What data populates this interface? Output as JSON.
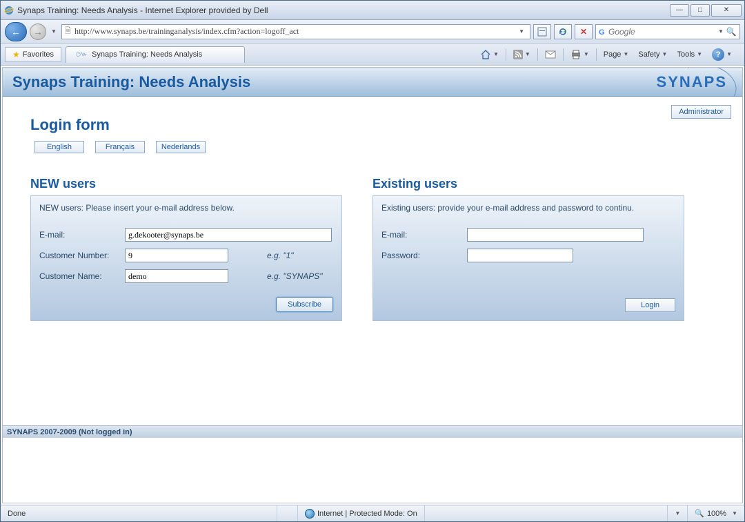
{
  "window": {
    "title": "Synaps Training: Needs Analysis - Internet Explorer provided by Dell"
  },
  "nav": {
    "url": "http://www.synaps.be/traininganalysis/index.cfm?action=logoff_act",
    "search_placeholder": "Google"
  },
  "tabbar": {
    "favorites_label": "Favorites",
    "tab_title": "Synaps Training: Needs Analysis"
  },
  "toolbar": {
    "page": "Page",
    "safety": "Safety",
    "tools": "Tools"
  },
  "page": {
    "header_title": "Synaps Training: Needs Analysis",
    "brand": "SYNAPS",
    "admin_btn": "Administrator",
    "form_title": "Login form",
    "lang": {
      "en": "English",
      "fr": "Français",
      "nl": "Nederlands"
    },
    "new": {
      "heading": "NEW users",
      "hint": "NEW users: Please insert your e-mail address below.",
      "email_label": "E-mail:",
      "email_value": "g.dekooter@synaps.be",
      "custnum_label": "Customer Number:",
      "custnum_value": "9",
      "custnum_eg": "e.g.  \"1\"",
      "custname_label": "Customer Name:",
      "custname_value": "demo",
      "custname_eg": "e.g.  \"SYNAPS\"",
      "submit": "Subscribe"
    },
    "existing": {
      "heading": "Existing users",
      "hint": "Existing users: provide your e-mail address and password to continu.",
      "email_label": "E-mail:",
      "pass_label": "Password:",
      "submit": "Login"
    },
    "footer": "SYNAPS 2007-2009 (Not logged in)"
  },
  "status": {
    "left": "Done",
    "zone": "Internet | Protected Mode: On",
    "zoom": "100%"
  }
}
